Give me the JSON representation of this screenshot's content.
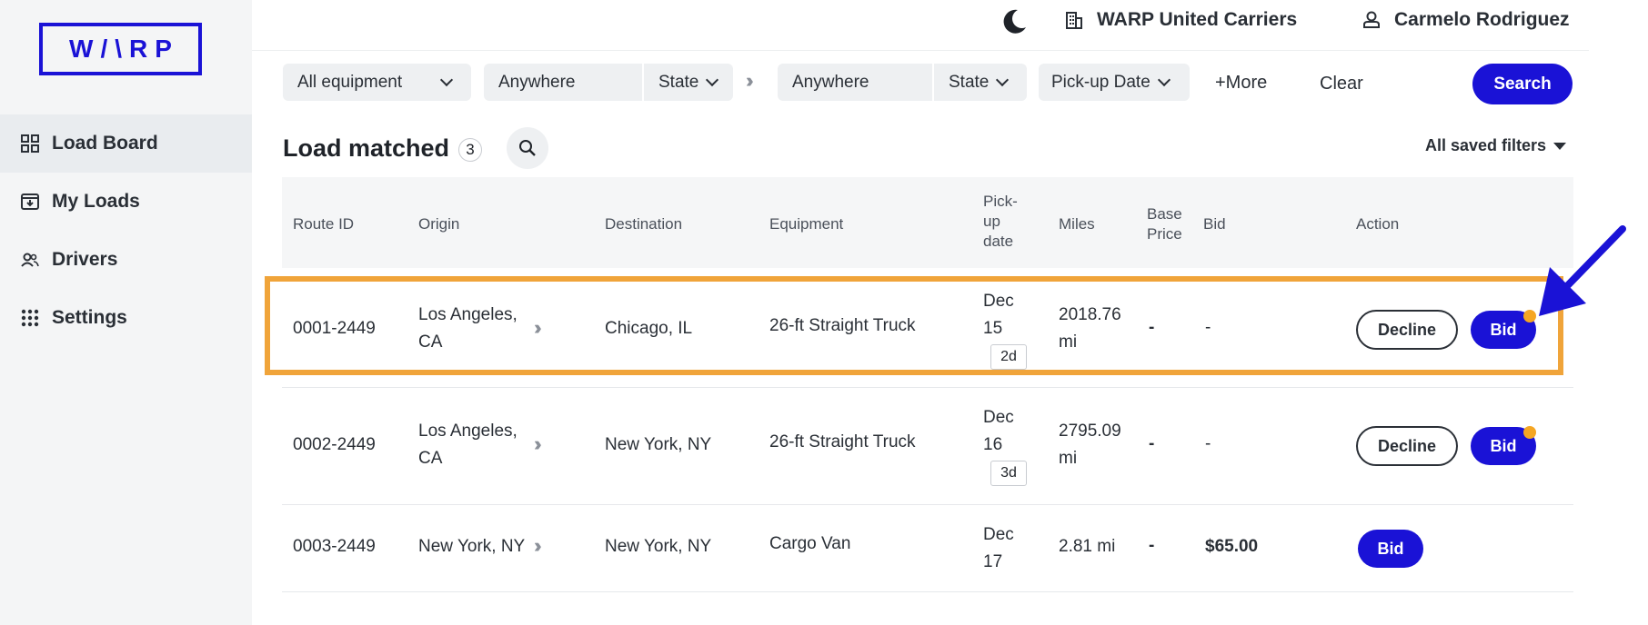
{
  "brand": {
    "logo_text": "W/\\RP",
    "accent_color": "#1a12d6",
    "highlight_color": "#f0a43a"
  },
  "sidebar": {
    "items": [
      {
        "label": "Load Board",
        "icon": "grid-icon",
        "active": true
      },
      {
        "label": "My Loads",
        "icon": "inbox-icon",
        "active": false
      },
      {
        "label": "Drivers",
        "icon": "users-icon",
        "active": false
      },
      {
        "label": "Settings",
        "icon": "dots-grid-icon",
        "active": false
      }
    ]
  },
  "header": {
    "theme_icon": "moon-icon",
    "company": "WARP United Carriers",
    "user": "Carmelo Rodriguez"
  },
  "filters": {
    "equipment": "All equipment",
    "origin_city": "Anywhere",
    "origin_state": "State",
    "dest_city": "Anywhere",
    "dest_state": "State",
    "pickup_date": "Pick-up Date",
    "more": "+More",
    "clear": "Clear",
    "search": "Search"
  },
  "results": {
    "title": "Load matched",
    "count": "3",
    "saved_filters": "All saved filters"
  },
  "table": {
    "headers": {
      "route_id": "Route ID",
      "origin": "Origin",
      "destination": "Destination",
      "equipment": "Equipment",
      "pickup_l1": "Pick-",
      "pickup_l2": "up",
      "pickup_l3": "date",
      "miles": "Miles",
      "base_l1": "Base",
      "base_l2": "Price",
      "bid": "Bid",
      "action": "Action"
    },
    "rows": [
      {
        "route_id": "0001-2449",
        "origin_l1": "Los Angeles,",
        "origin_l2": "CA",
        "destination": "Chicago, IL",
        "equipment": "26-ft Straight Truck",
        "pickup_month": "Dec",
        "pickup_day": "15",
        "pickup_tag": "2d",
        "miles_l1": "2018.76",
        "miles_l2": "mi",
        "base_price": "-",
        "bid": "-",
        "decline_label": "Decline",
        "bid_label": "Bid"
      },
      {
        "route_id": "0002-2449",
        "origin_l1": "Los Angeles,",
        "origin_l2": "CA",
        "destination": "New York, NY",
        "equipment": "26-ft Straight Truck",
        "pickup_month": "Dec",
        "pickup_day": "16",
        "pickup_tag": "3d",
        "miles_l1": "2795.09",
        "miles_l2": "mi",
        "base_price": "-",
        "bid": "-",
        "decline_label": "Decline",
        "bid_label": "Bid"
      },
      {
        "route_id": "0003-2449",
        "origin_l1": "New York, NY",
        "destination": "New York, NY",
        "equipment": "Cargo Van",
        "pickup_month": "Dec",
        "pickup_day": "17",
        "miles_l1": "2.81 mi",
        "base_price": "-",
        "bid": "$65.00",
        "bid_label": "Bid"
      }
    ]
  }
}
